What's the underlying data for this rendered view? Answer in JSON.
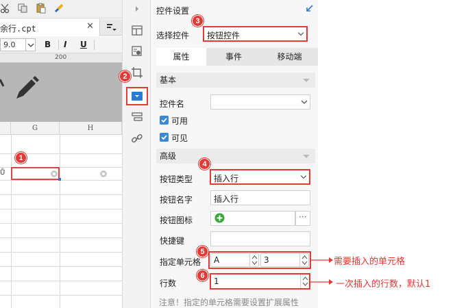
{
  "toolbar": {
    "icons": [
      "cut-icon",
      "copy-icon",
      "paste-icon",
      "format-painter-icon"
    ]
  },
  "file_tab": {
    "label": "余行.cpt",
    "close": "✕"
  },
  "format_bar": {
    "font_size": "9.0",
    "bold": "B",
    "italic": "I",
    "underline": "U"
  },
  "ruler": {
    "mark": "200"
  },
  "sheet": {
    "columns": [
      "G",
      "H"
    ]
  },
  "panel": {
    "title": "控件设置",
    "select_control_label": "选择控件",
    "select_control_value": "按钮控件",
    "tabs": [
      "属性",
      "事件",
      "移动端"
    ],
    "active_tab": "属性",
    "basic_section": "基本",
    "control_name_label": "控件名",
    "control_name_value": "",
    "enabled_label": "可用",
    "visible_label": "可见",
    "advanced_section": "高级",
    "button_type_label": "按钮类型",
    "button_type_value": "插入行",
    "button_name_label": "按钮名字",
    "button_name_value": "插入行",
    "button_icon_label": "按钮图标",
    "button_icon_more": "···",
    "shortcut_label": "快捷键",
    "shortcut_value": "",
    "cell_label": "指定单元格",
    "cell_col_value": "A",
    "cell_row_value": "3",
    "rows_label": "行数",
    "rows_value": "1",
    "note": "注意！指定的单元格需要设置扩展属性"
  },
  "badges": [
    "1",
    "2",
    "3",
    "4",
    "5",
    "6"
  ],
  "annotations": {
    "cell_note": "需要插入的单元格",
    "rows_note": "一次插入的行数，默认1"
  },
  "colors": {
    "accent_red": "#e53935",
    "checkbox_blue": "#3b87d4",
    "select_blue": "#2b7bd4"
  }
}
